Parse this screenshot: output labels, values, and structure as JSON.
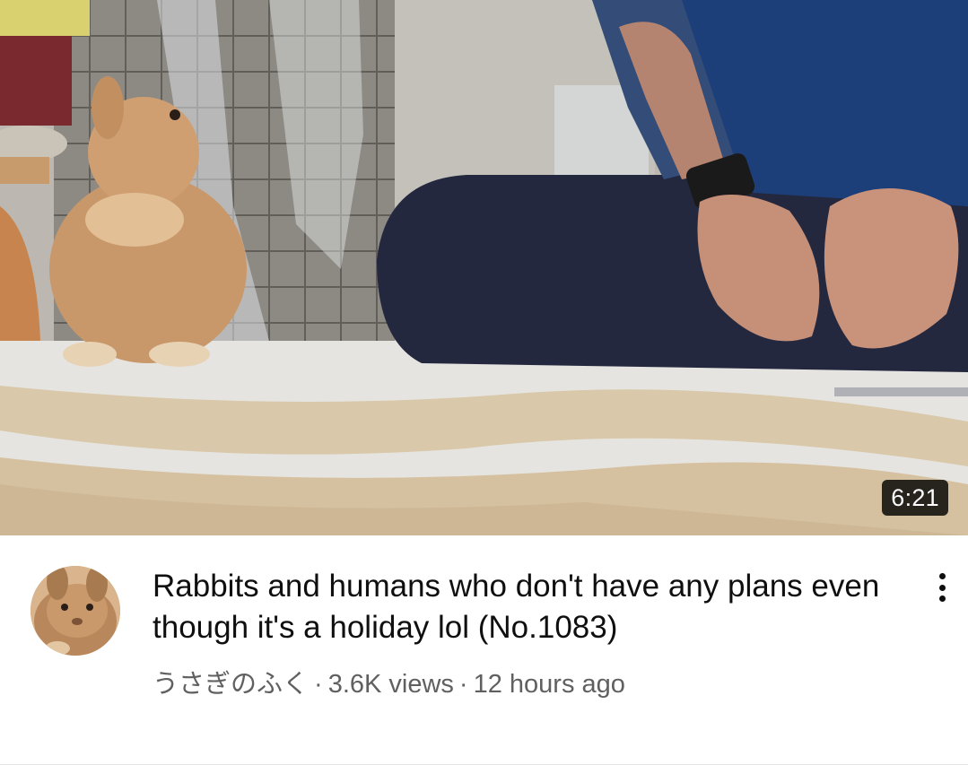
{
  "video": {
    "duration": "6:21",
    "title": "Rabbits and humans who don't have any plans even though it's a holiday lol (No.1083)",
    "channel_name": "うさぎのふく",
    "views": "3.6K views",
    "uploaded": "12 hours ago",
    "separator": "·"
  },
  "icons": {
    "more": "more-vertical-icon"
  },
  "colors": {
    "title": "#0f0f0f",
    "meta": "#606060",
    "badge_bg": "#000000",
    "badge_text": "#ffffff"
  }
}
